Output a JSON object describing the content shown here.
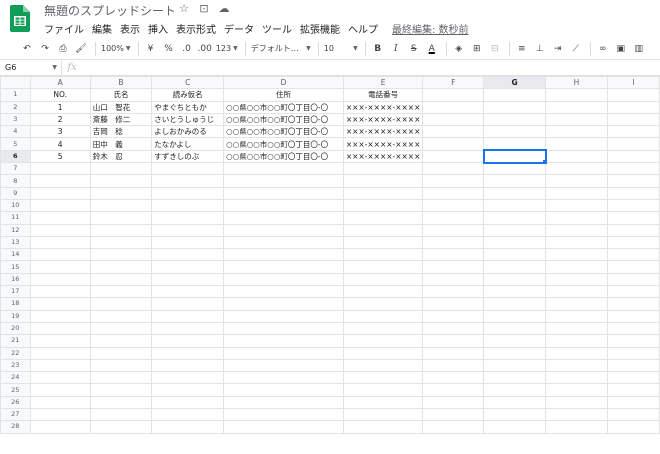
{
  "app": {
    "title": "無題のスプレッドシート",
    "brand_color": "#0f9d58",
    "title_icons": [
      "star-icon",
      "move-folder-icon",
      "cloud-status-icon"
    ]
  },
  "menu": {
    "items": [
      "ファイル",
      "編集",
      "表示",
      "挿入",
      "表示形式",
      "データ",
      "ツール",
      "拡張機能",
      "ヘルプ"
    ],
    "last_edit": "最終編集: 数秒前"
  },
  "toolbar": {
    "zoom": "100%",
    "currency": "¥",
    "percent": "%",
    "decrease_decimal": ".0",
    "increase_decimal": ".00",
    "more_formats": "123",
    "font": "デフォルト…",
    "font_size": "10",
    "bold": "B",
    "italic": "I",
    "strike": "S",
    "text_color": "A"
  },
  "formula_bar": {
    "cell_ref": "G6",
    "fx": "fx",
    "value": ""
  },
  "grid": {
    "columns": [
      "A",
      "B",
      "C",
      "D",
      "E",
      "F",
      "G",
      "H",
      "I"
    ],
    "selected_cell": "G6",
    "selection_color": "#1a73e8",
    "rows": [
      [
        "NO.",
        "氏名",
        "読み仮名",
        "住所",
        "電話番号",
        "",
        "",
        "",
        ""
      ],
      [
        "1",
        "山口　智花",
        "やまぐちともか",
        "○○県○○市○○町〇丁目〇-〇",
        "×××-××××-××××",
        "",
        "",
        "",
        ""
      ],
      [
        "2",
        "斎藤　修二",
        "さいとうしゅうじ",
        "○○県○○市○○町〇丁目〇-〇",
        "×××-××××-××××",
        "",
        "",
        "",
        ""
      ],
      [
        "3",
        "吉岡　稔",
        "よしおかみのる",
        "○○県○○市○○町〇丁目〇-〇",
        "×××-××××-××××",
        "",
        "",
        "",
        ""
      ],
      [
        "4",
        "田中　義",
        "たなかよし",
        "○○県○○市○○町〇丁目〇-〇",
        "×××-××××-××××",
        "",
        "",
        "",
        ""
      ],
      [
        "5",
        "鈴木　忍",
        "すずきしのぶ",
        "○○県○○市○○町〇丁目〇-〇",
        "×××-××××-××××",
        "",
        "",
        "",
        ""
      ]
    ],
    "total_rows": 28
  }
}
